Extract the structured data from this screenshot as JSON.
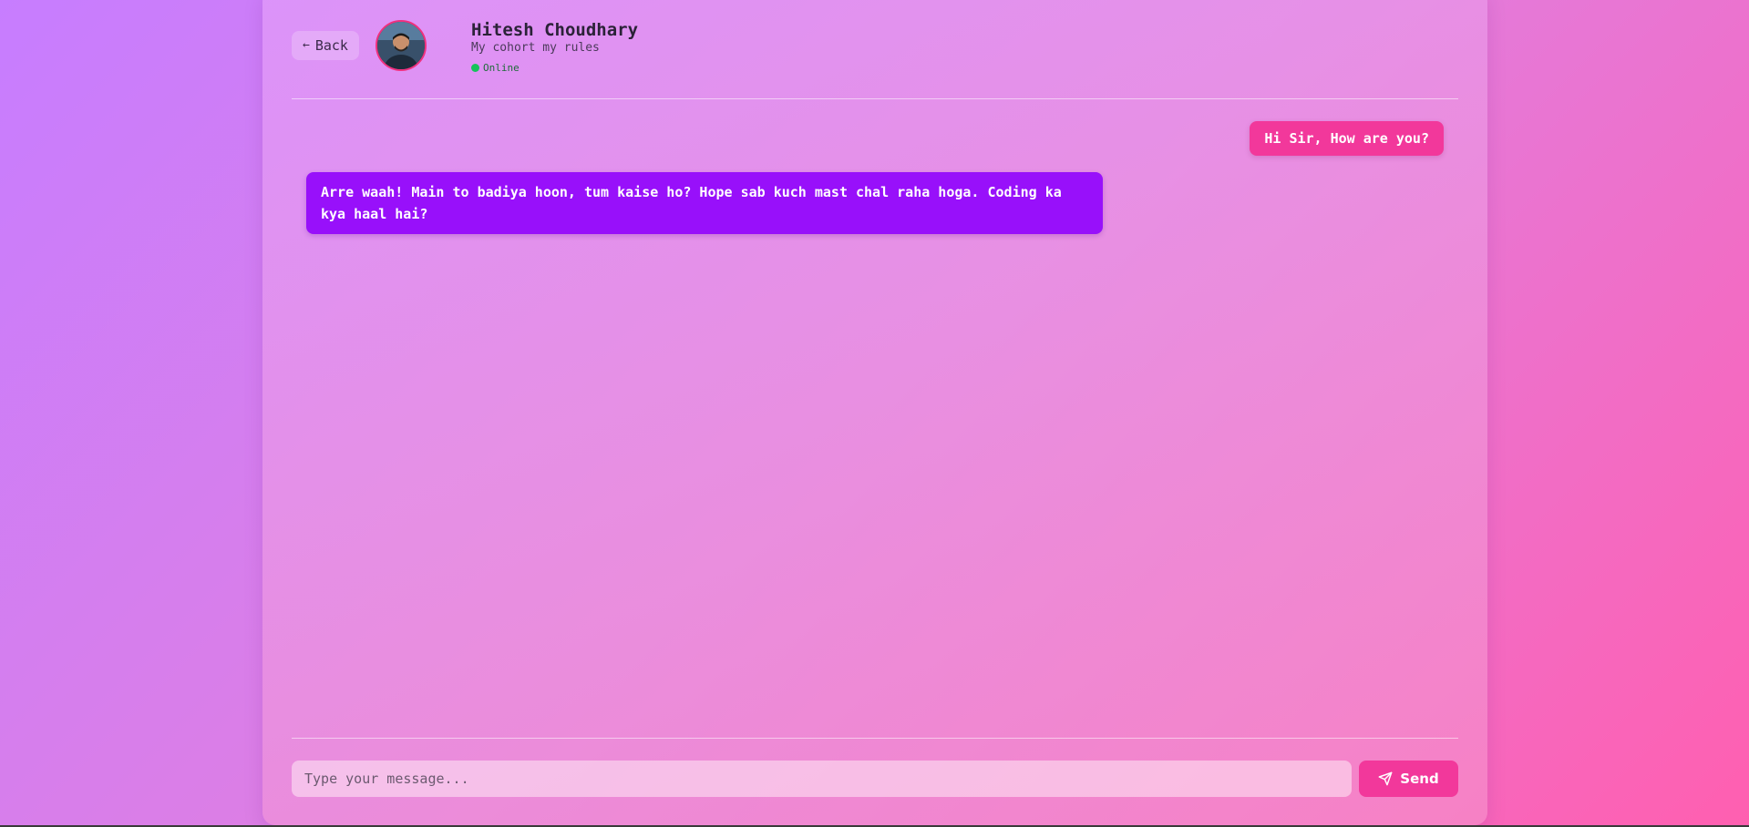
{
  "header": {
    "back_label": "Back",
    "back_icon": "arrow-left-icon",
    "profile": {
      "name": "Hitesh Choudhary",
      "tagline": "My cohort my rules",
      "status": "Online",
      "status_color": "#16c35a",
      "avatar_border_color": "#f0307e"
    }
  },
  "messages": [
    {
      "sender": "user",
      "text": "Hi Sir, How are you?",
      "color": "#f2389b"
    },
    {
      "sender": "bot",
      "text": "Arre waah! Main to badiya hoon, tum kaise ho? Hope sab kuch mast chal raha hoga. Coding ka kya haal hai?",
      "color": "#9810fa"
    }
  ],
  "composer": {
    "placeholder": "Type your message...",
    "value": "",
    "send_label": "Send",
    "send_icon": "send-icon",
    "send_color": "#f2389b"
  },
  "theme": {
    "background_start": "#c77dff",
    "background_end": "#ff5fb0"
  }
}
